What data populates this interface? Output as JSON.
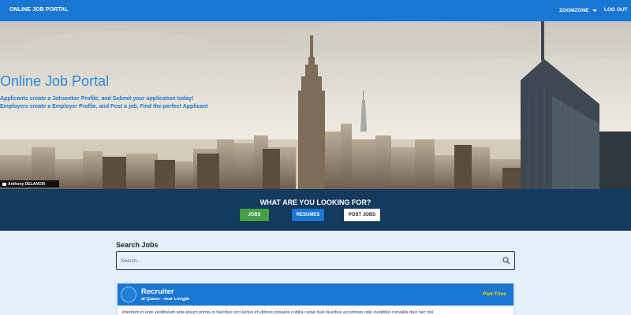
{
  "navbar": {
    "brand": "ONLINE JOB PORTAL",
    "user_menu": "ZOOMZONE",
    "logout": "LOG OUT"
  },
  "hero": {
    "title": "Online Job Portal",
    "line1": "Applicants create a Jobseeker Profile, and Submit your application today!",
    "line2": "Employers create a Employer Profile, and Post a job, Find the perfect Applicant",
    "photo_credit": "Anthony DELANOIX"
  },
  "looking": {
    "title": "WHAT ARE YOU LOOKING FOR?",
    "buttons": {
      "jobs": "JOBS",
      "resumes": "RESUMES",
      "post_jobs": "POST JOBS"
    }
  },
  "search": {
    "title": "Search Jobs",
    "placeholder": "Search..."
  },
  "job": {
    "title": "Recruiter",
    "company": "at Quaxo - near Longjin",
    "type": "Part-Time",
    "description": "interdum in ante vestibulum ante ipsum primis in faucibus orci luctus et ultrices posuere cubilia curae duis faucibus accumsan odio curabitur convallis duis nec nisi"
  },
  "colors": {
    "navbar": "#1976d2",
    "accent_blue": "#2a8be0",
    "band": "#143a5e",
    "jobs_button": "#43a047",
    "page_bg": "#e3f1fc",
    "job_type": "#ffd600"
  },
  "icons": [
    "caret-down-icon",
    "camera-icon",
    "search-icon"
  ]
}
